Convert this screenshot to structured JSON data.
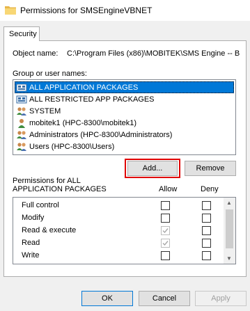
{
  "window": {
    "title": "Permissions for SMSEngineVBNET"
  },
  "tabs": [
    {
      "label": "Security"
    }
  ],
  "object": {
    "label": "Object name:",
    "value": "C:\\Program Files (x86)\\MOBITEK\\SMS Engine -- B"
  },
  "group": {
    "label": "Group or user names:",
    "items": [
      {
        "label": "ALL APPLICATION PACKAGES",
        "icon": "package-group-icon",
        "selected": true
      },
      {
        "label": "ALL RESTRICTED APP PACKAGES",
        "icon": "package-group-icon",
        "selected": false
      },
      {
        "label": "SYSTEM",
        "icon": "users-group-icon",
        "selected": false
      },
      {
        "label": "mobitek1 (HPC-8300\\mobitek1)",
        "icon": "user-icon",
        "selected": false
      },
      {
        "label": "Administrators (HPC-8300\\Administrators)",
        "icon": "users-group-icon",
        "selected": false
      },
      {
        "label": "Users (HPC-8300\\Users)",
        "icon": "users-group-icon",
        "selected": false
      }
    ]
  },
  "buttons": {
    "add": "Add...",
    "remove": "Remove",
    "ok": "OK",
    "cancel": "Cancel",
    "apply": "Apply"
  },
  "permissions": {
    "title_line1": "Permissions for ALL",
    "title_line2": "APPLICATION PACKAGES",
    "allow_header": "Allow",
    "deny_header": "Deny",
    "rows": [
      {
        "label": "Full control",
        "allow": "unchecked",
        "deny": "unchecked"
      },
      {
        "label": "Modify",
        "allow": "unchecked",
        "deny": "unchecked"
      },
      {
        "label": "Read & execute",
        "allow": "checked-disabled",
        "deny": "unchecked"
      },
      {
        "label": "Read",
        "allow": "checked-disabled",
        "deny": "unchecked"
      },
      {
        "label": "Write",
        "allow": "unchecked",
        "deny": "unchecked"
      }
    ]
  },
  "colors": {
    "selection": "#0078d7",
    "highlight": "#e00000"
  }
}
